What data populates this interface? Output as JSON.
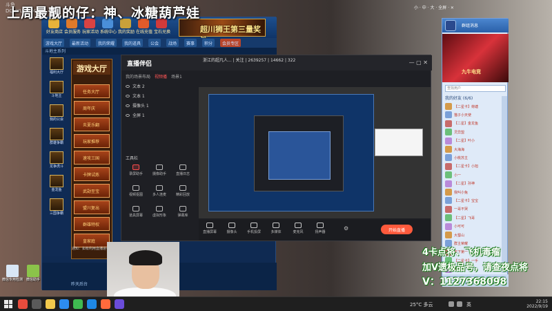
{
  "overlay": {
    "title": "上周最靓的仔：神、冰糖葫芦娃",
    "site_logo": "斗鱼 DOUYU.COM"
  },
  "lobby": {
    "top_icons": [
      "好友商店",
      "会员服务",
      "玩家活动",
      "系统中心",
      "我的奖励",
      "在线充值",
      "宝石兑换"
    ],
    "ad_text": "超川狮王第三量奖池",
    "tabs": [
      "游戏大厅",
      "最新活动",
      "我的荣耀",
      "我的道具",
      "公会",
      "战场",
      "赛事",
      "积分",
      "会员专区"
    ],
    "sub_label": "斗地主系列",
    "side_games": [
      "福利大厅",
      "斗地主",
      "我的公会",
      "群雄争霸",
      "龙争虎斗",
      "金龙鱼",
      "三国争霸"
    ],
    "hall_title": "游戏大厅",
    "hall_buttons": [
      "任务大厅",
      "周年庆",
      "炎夏乐翻",
      "玩家推荐",
      "速攻三国",
      "卡牌试炼",
      "武勋至宝",
      "盟川复出",
      "群雄特权",
      "皇家庭"
    ],
    "bottom_text": "昨天后台"
  },
  "obs": {
    "app_name": "直播伴侣",
    "top_info": "浙江的超凡人... | 关注 | 2639257 | 14662 | 322",
    "tabs": [
      "我的场景",
      "布局",
      "视频播",
      "场景1"
    ],
    "scenes": [
      "文本 2",
      "文本 1",
      "摄像头 1",
      "全屏 1"
    ],
    "tool_header": "工具栏",
    "tools": [
      "录屏助手",
      "摄像助手",
      "直播日志",
      "视频抠图",
      "多人连麦",
      "精彩回放",
      "道具屏幕",
      "虚拟形象",
      "弹幕库",
      "其他"
    ],
    "controls": [
      "直播屏幕",
      "摄像头",
      "手机投屏",
      "多媒体",
      "麦克风",
      "扬声器"
    ],
    "start_button": "开始直播",
    "status_bar": "通知：如有利用直播进行违法违规行为，请立即联系斗鱼客服举报"
  },
  "chat": {
    "header": "群组消息",
    "ad_text": "九牛电竞",
    "search_placeholder": "查找用户",
    "section": "我的好友 (6/6)",
    "members": [
      "【二星卡】荷塘",
      "猫子小天使",
      "【二星】金龙鱼",
      "灵异盟",
      "【二星】叶小",
      "大海海",
      "小桃苏主",
      "【二星卡】小旭",
      "小一",
      "【二星】孙神",
      "我叫小兔",
      "【二星卡】宝宝",
      "一哥不哭",
      "【二星】飞哥",
      "小可可",
      "大蜀山",
      "群主荣耀",
      "天下第一",
      "【二星卡】一手",
      "小孩子"
    ],
    "buttons": [
      "换一换",
      "空间",
      "关闭"
    ]
  },
  "promo": {
    "line1": "4卡点将、飞机毒瘤",
    "line2": "加V遗极品号，请查夜点将",
    "line3": "V：1127368098"
  },
  "desktop": {
    "icons": [
      "微信专用检测",
      "微信助手"
    ]
  },
  "taskbar": {
    "weather": "25°C 多云",
    "time": "22:15",
    "date": "2022/9/19",
    "lang": "英"
  },
  "window_controls": "小 · 中 · 大 · 全屏 · ✕",
  "colors": {
    "lobby_blue": "#0f2a52",
    "obs_dark": "#1e1f24",
    "start_orange": "#ff5a3c",
    "promo_green": "#1b7b1b"
  }
}
